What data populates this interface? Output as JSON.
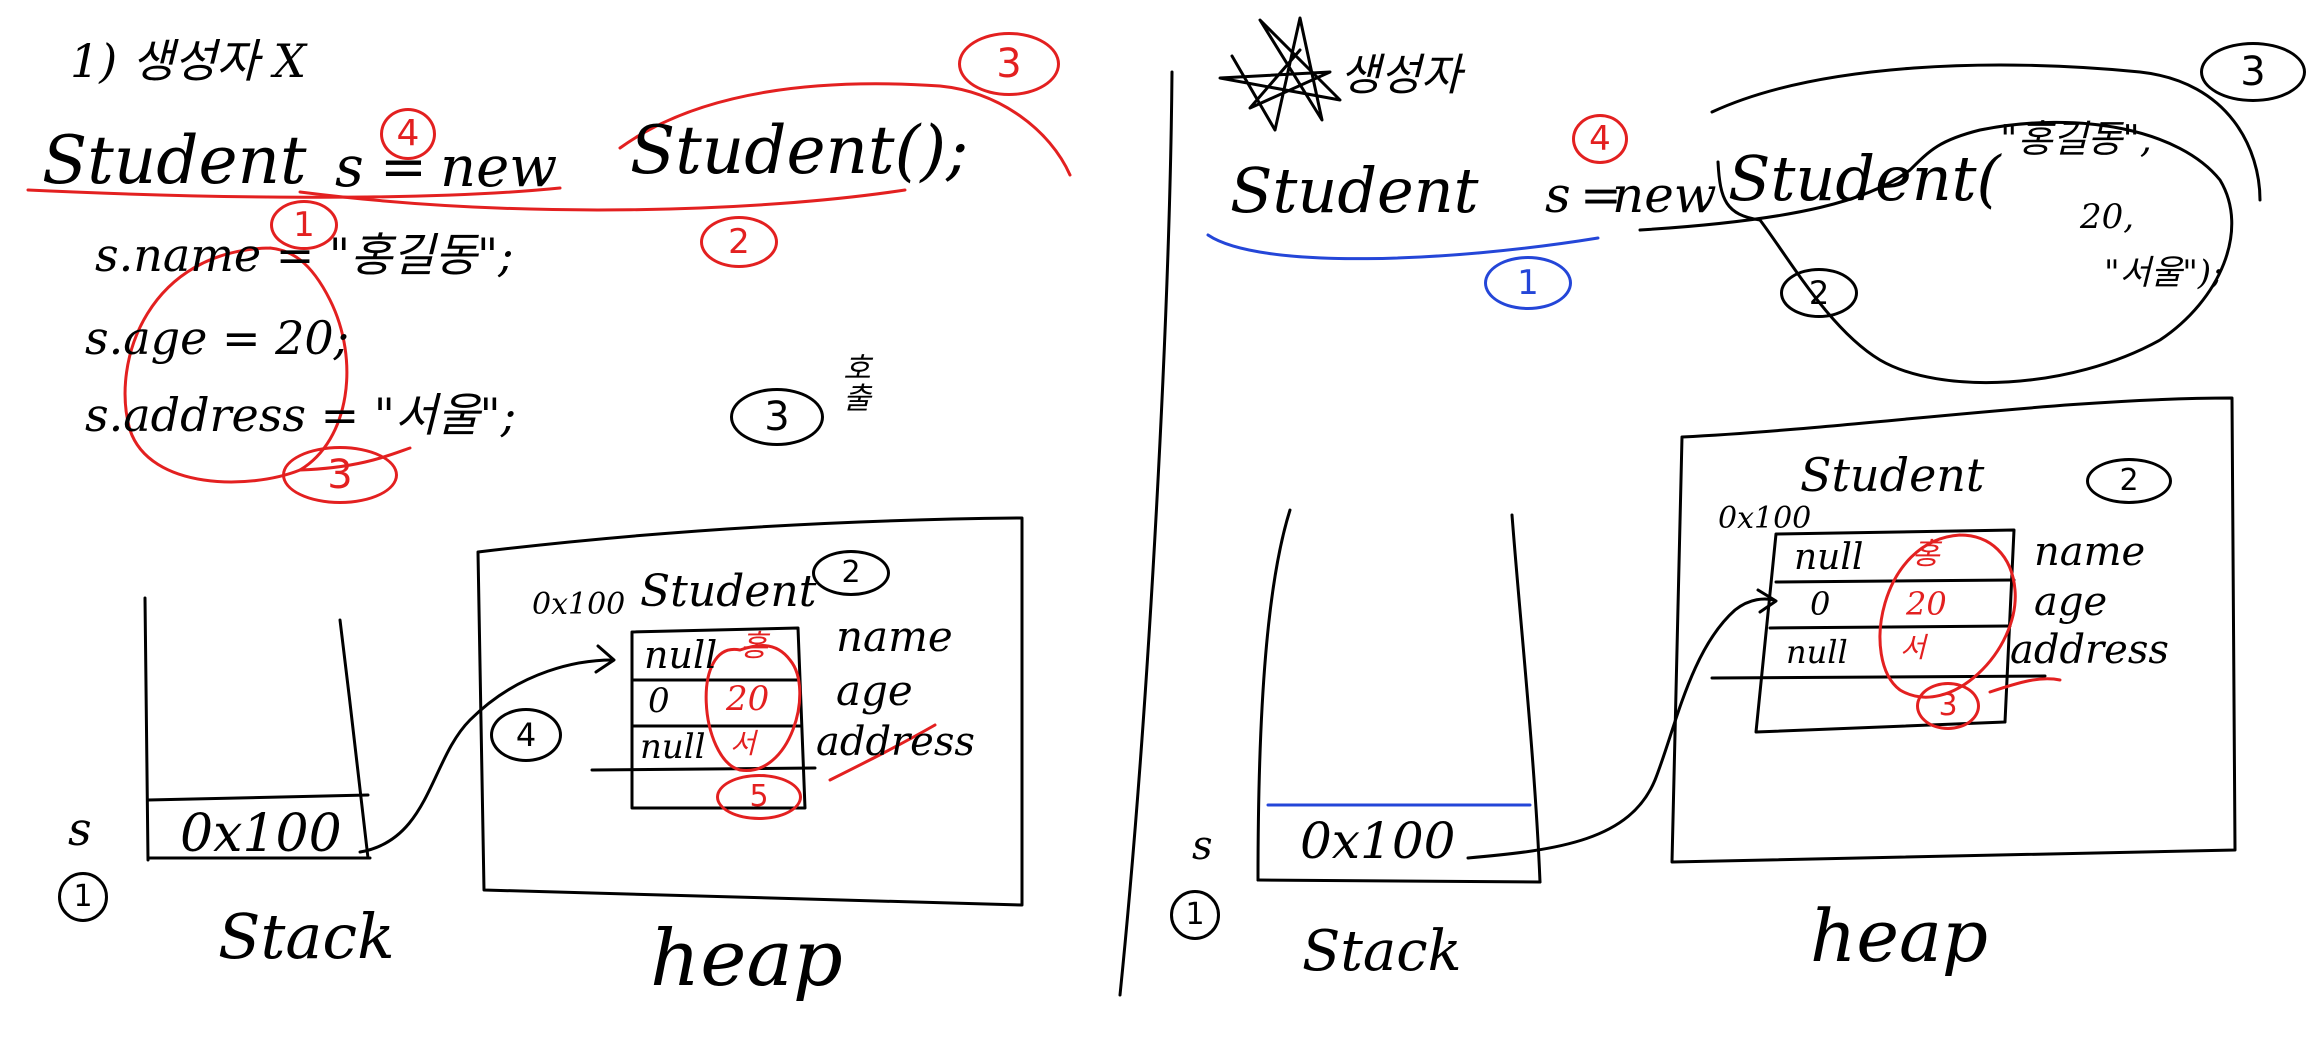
{
  "colors": {
    "ink": "#000000",
    "red": "#e32020",
    "blue": "#2446d8"
  },
  "left": {
    "heading": "1) 생성자 X",
    "code_line": "Student s = new Student();",
    "code_line_parts": {
      "type": "Student",
      "var": "s",
      "eq": "=",
      "new": "new",
      "ctor": "Student();"
    },
    "assignments": [
      "s.name = \"홍길동\";",
      "s.age = 20;",
      "s.address = \"서울\";"
    ],
    "step_marks": {
      "declare": "1",
      "instantiate": "2",
      "constructor": "3",
      "assign": "4",
      "fields": "3",
      "address_mark": "5"
    },
    "note_3": "3",
    "note_side": "호출",
    "stack": {
      "var": "s",
      "value": "0x100",
      "label": "Stack",
      "step": "1"
    },
    "heap": {
      "address": "0x100",
      "class": "Student",
      "class_step": "2",
      "arrow_step": "4",
      "label": "heap",
      "fields": [
        {
          "default": "null",
          "assigned": "홍",
          "name": "name"
        },
        {
          "default": "0",
          "assigned": "20",
          "name": "age"
        },
        {
          "default": "null",
          "assigned": "서",
          "name": "address"
        }
      ]
    }
  },
  "right": {
    "heading": "생성자",
    "code_line": "Student s = new Student(\"홍길동\", 20, \"서울\");",
    "code_parts": {
      "type": "Student",
      "var": "s",
      "eq": "=",
      "new": "new",
      "ctor": "Student(",
      "arg1": "\"홍길동\",",
      "arg2": "20,",
      "arg3": "\"서울\");"
    },
    "step_marks": {
      "declare": "1",
      "instantiate": "2",
      "constructor": "3",
      "assign": "4"
    },
    "stack": {
      "var": "s",
      "value": "0x100",
      "label": "Stack",
      "step": "1"
    },
    "heap": {
      "address": "0x100",
      "class": "Student",
      "class_step": "2",
      "init_step": "3",
      "label": "heap",
      "fields": [
        {
          "default": "null",
          "assigned": "홍",
          "name": "name"
        },
        {
          "default": "0",
          "assigned": "20",
          "name": "age"
        },
        {
          "default": "null",
          "assigned": "서",
          "name": "address"
        }
      ]
    }
  }
}
